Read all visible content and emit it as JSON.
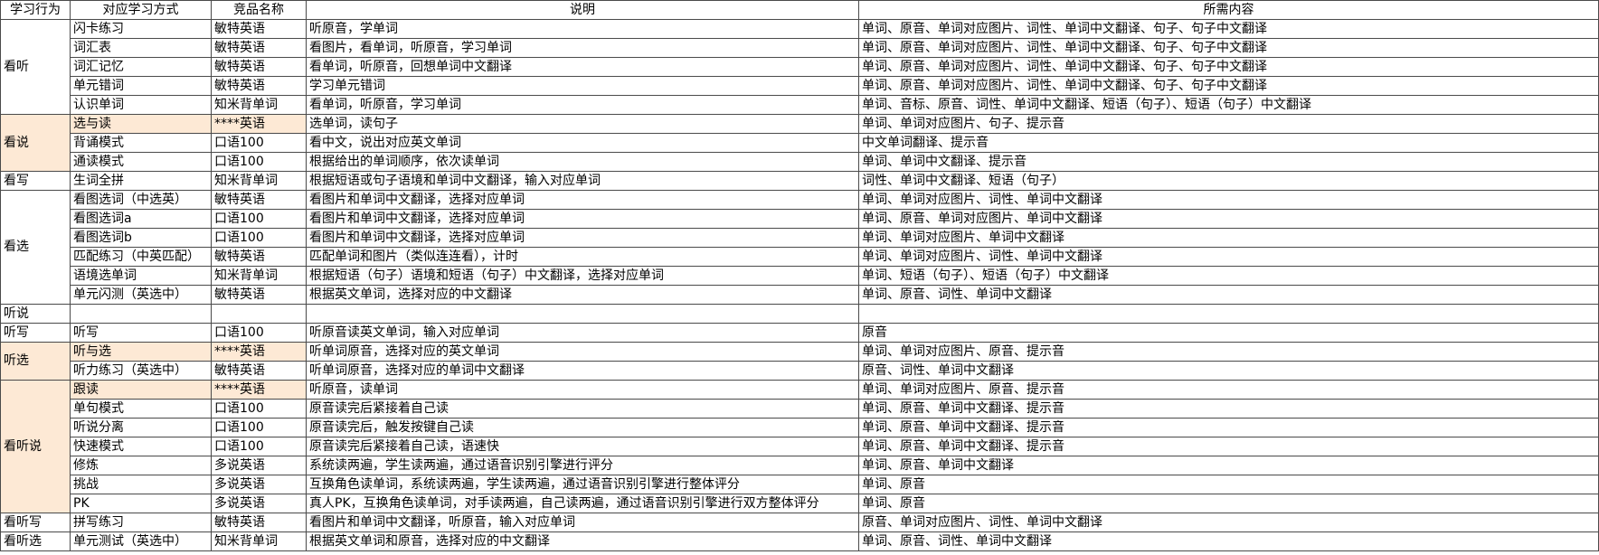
{
  "table": {
    "columns": [
      "学习行为",
      "对应学习方式",
      "竞品名称",
      "说明",
      "所需内容"
    ],
    "highlight_color": "#fde9d5",
    "groups": [
      {
        "behavior": "看听",
        "highlight": false,
        "rows": [
          {
            "method": "闪卡练习",
            "product": "敏特英语",
            "desc": "听原音，学单词",
            "content": "单词、原音、单词对应图片、词性、单词中文翻译、句子、句子中文翻译",
            "highlight": false
          },
          {
            "method": "词汇表",
            "product": "敏特英语",
            "desc": "看图片，看单词，听原音，学习单词",
            "content": "单词、原音、单词对应图片、词性、单词中文翻译、句子、句子中文翻译",
            "highlight": false
          },
          {
            "method": "词汇记忆",
            "product": "敏特英语",
            "desc": "看单词，听原音，回想单词中文翻译",
            "content": "单词、原音、单词对应图片、词性、单词中文翻译、句子、句子中文翻译",
            "highlight": false
          },
          {
            "method": "单元错词",
            "product": "敏特英语",
            "desc": "学习单元错词",
            "content": "单词、原音、单词对应图片、词性、单词中文翻译、句子、句子中文翻译",
            "highlight": false
          },
          {
            "method": "认识单词",
            "product": "知米背单词",
            "desc": "看单词，听原音，学习单词",
            "content": "单词、音标、原音、词性、单词中文翻译、短语（句子）、短语（句子）中文翻译",
            "highlight": false
          }
        ]
      },
      {
        "behavior": "看说",
        "highlight": true,
        "rows": [
          {
            "method": "选与读",
            "product": "****英语",
            "desc": "选单词，读句子",
            "content": "单词、单词对应图片、句子、提示音",
            "highlight": true
          },
          {
            "method": "背诵模式",
            "product": "口语100",
            "desc": "看中文，说出对应英文单词",
            "content": "中文单词翻译、提示音",
            "highlight": false
          },
          {
            "method": "通读模式",
            "product": "口语100",
            "desc": "根据给出的单词顺序，依次读单词",
            "content": "单词、单词中文翻译、提示音",
            "highlight": false
          }
        ]
      },
      {
        "behavior": "看写",
        "highlight": false,
        "rows": [
          {
            "method": "生词全拼",
            "product": "知米背单词",
            "desc": "根据短语或句子语境和单词中文翻译，输入对应单词",
            "content": "词性、单词中文翻译、短语（句子）",
            "highlight": false
          }
        ]
      },
      {
        "behavior": "看选",
        "highlight": false,
        "rows": [
          {
            "method": "看图选词（中选英）",
            "product": "敏特英语",
            "desc": "看图片和单词中文翻译，选择对应单词",
            "content": "单词、单词对应图片、词性、单词中文翻译",
            "highlight": false
          },
          {
            "method": "看图选词a",
            "product": "口语100",
            "desc": "看图片和单词中文翻译，选择对应单词",
            "content": "单词、原音、单词对应图片、单词中文翻译",
            "highlight": false
          },
          {
            "method": "看图选词b",
            "product": "口语100",
            "desc": "看图片和单词中文翻译，选择对应单词",
            "content": "单词、单词对应图片、单词中文翻译",
            "highlight": false
          },
          {
            "method": "匹配练习（中英匹配）",
            "product": "敏特英语",
            "desc": "匹配单词和图片（类似连连看），计时",
            "content": "单词、单词对应图片、词性、单词中文翻译",
            "highlight": false
          },
          {
            "method": "语境选单词",
            "product": "知米背单词",
            "desc": "根据短语（句子）语境和短语（句子）中文翻译，选择对应单词",
            "content": "单词、短语（句子）、短语（句子）中文翻译",
            "highlight": false
          },
          {
            "method": "单元闪测（英选中）",
            "product": "敏特英语",
            "desc": "根据英文单词，选择对应的中文翻译",
            "content": "单词、原音、词性、单词中文翻译",
            "highlight": false
          }
        ]
      },
      {
        "behavior": "听说",
        "highlight": false,
        "rows": [
          {
            "method": "",
            "product": "",
            "desc": "",
            "content": "",
            "highlight": false
          }
        ]
      },
      {
        "behavior": "听写",
        "highlight": false,
        "rows": [
          {
            "method": "听写",
            "product": "口语100",
            "desc": "听原音读英文单词，输入对应单词",
            "content": "原音",
            "highlight": false
          }
        ]
      },
      {
        "behavior": "听选",
        "highlight": true,
        "rows": [
          {
            "method": "听与选",
            "product": "****英语",
            "desc": "听单词原音，选择对应的英文单词",
            "content": "单词、单词对应图片、原音、提示音",
            "highlight": true
          },
          {
            "method": "听力练习（英选中）",
            "product": "敏特英语",
            "desc": "听单词原音，选择对应的单词中文翻译",
            "content": "原音、词性、单词中文翻译",
            "highlight": false
          }
        ]
      },
      {
        "behavior": "看听说",
        "highlight": true,
        "rows": [
          {
            "method": "跟读",
            "product": "****英语",
            "desc": "听原音，读单词",
            "content": "单词、单词对应图片、原音、提示音",
            "highlight": true
          },
          {
            "method": "单句模式",
            "product": "口语100",
            "desc": "原音读完后紧接着自己读",
            "content": "单词、原音、单词中文翻译、提示音",
            "highlight": false
          },
          {
            "method": "听说分离",
            "product": "口语100",
            "desc": "原音读完后，触发按键自己读",
            "content": "单词、原音、单词中文翻译、提示音",
            "highlight": false
          },
          {
            "method": "快速模式",
            "product": "口语100",
            "desc": "原音读完后紧接着自己读，语速快",
            "content": "单词、原音、单词中文翻译、提示音",
            "highlight": false
          },
          {
            "method": "修炼",
            "product": "多说英语",
            "desc": "系统读两遍，学生读两遍，通过语音识别引擎进行评分",
            "content": "单词、原音、单词中文翻译",
            "highlight": false
          },
          {
            "method": "挑战",
            "product": "多说英语",
            "desc": "互换角色读单词，系统读两遍，学生读两遍，通过语音识别引擎进行整体评分",
            "content": "单词、原音",
            "highlight": false
          },
          {
            "method": "PK",
            "product": "多说英语",
            "desc": "真人PK，互换角色读单词，对手读两遍，自己读两遍，通过语音识别引擎进行双方整体评分",
            "content": "单词、原音",
            "highlight": false
          }
        ]
      },
      {
        "behavior": "看听写",
        "highlight": false,
        "rows": [
          {
            "method": "拼写练习",
            "product": "敏特英语",
            "desc": "看图片和单词中文翻译，听原音，输入对应单词",
            "content": "原音、单词对应图片、词性、单词中文翻译",
            "highlight": false
          }
        ]
      },
      {
        "behavior": "看听选",
        "highlight": false,
        "rows": [
          {
            "method": "单元测试（英选中）",
            "product": "知米背单词",
            "desc": "根据英文单词和原音，选择对应的中文翻译",
            "content": "单词、原音、词性、单词中文翻译",
            "highlight": false
          }
        ]
      }
    ]
  }
}
